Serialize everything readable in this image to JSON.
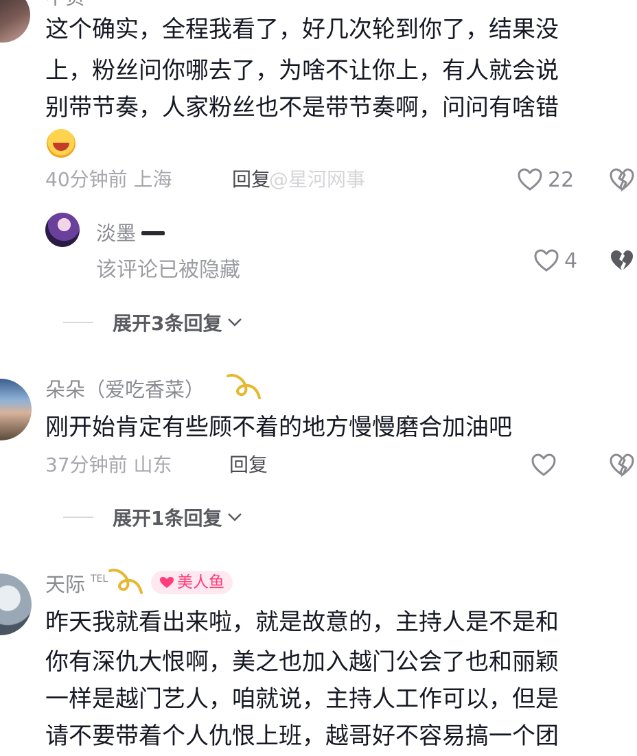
{
  "comments": [
    {
      "name": "不负",
      "lines": [
        "这个确实，全程我看了，好几次轮到你了，结果没",
        "上，粉丝问你哪去了，为啥不让你上，有人就会说",
        "别带节奏，人家粉丝也不是带节奏啊，问问有啥错"
      ],
      "time_location": "40分钟前 上海",
      "reply_label": "回复",
      "likes": "22",
      "watermark": "@星河网事",
      "replies": [
        {
          "name": "淡墨",
          "hidden_text": "该评论已被隐藏",
          "likes": "4"
        }
      ],
      "expand_label": "展开3条回复"
    },
    {
      "name": "朵朵（爱吃香菜）",
      "lines": [
        "刚开始肯定有些顾不着的地方慢慢磨合加油吧"
      ],
      "time_location": "37分钟前 山东",
      "reply_label": "回复",
      "expand_label": "展开1条回复"
    },
    {
      "name": "天际",
      "name_suffix": "TEL",
      "badge": "美人鱼",
      "lines": [
        "昨天我就看出来啦，就是故意的，主持人是不是和",
        "你有深仇大恨啊，美之也加入越门公会了也和丽颖",
        "一样是越门艺人，咱就说，主持人工作可以，但是",
        "请不要带着个人仇恨上班，越哥好不容易搞一个团"
      ]
    }
  ],
  "icons": {
    "like": "heart-outline-icon",
    "dislike": "broken-heart-icon",
    "expand": "chevron-down-icon"
  },
  "colors": {
    "text": "#161823",
    "muted": "#a6a7ad",
    "badge_bg": "#ffe9f0",
    "badge_text": "#ff3d7a"
  }
}
